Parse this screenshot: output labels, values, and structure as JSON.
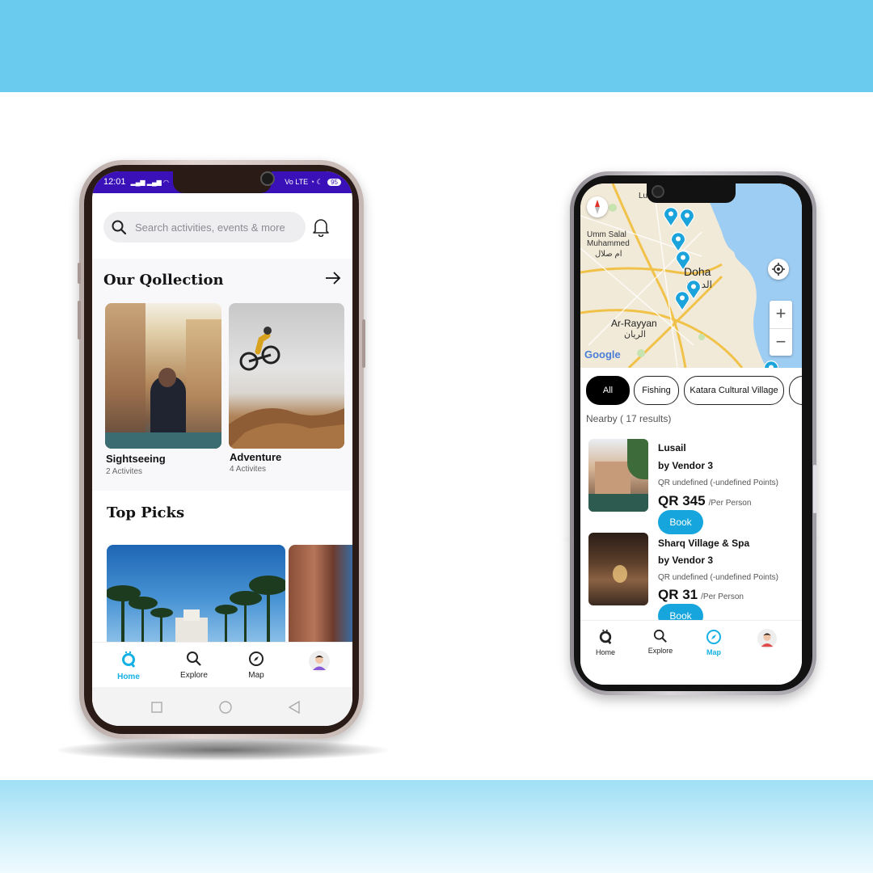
{
  "colors": {
    "brand_blue": "#16a6dd",
    "status_purple": "#3a10b8",
    "active_nav": "#16b1e4"
  },
  "phone1": {
    "status": {
      "time": "12:01",
      "battery": "95"
    },
    "search": {
      "placeholder": "Search activities, events & more",
      "search_icon": "search-icon",
      "bell_icon": "bell-icon"
    },
    "collection": {
      "title": "Our Qollection",
      "arrow_icon": "arrow-right-icon",
      "cards": [
        {
          "label": "Sightseeing",
          "sub": "2 Activites"
        },
        {
          "label": "Adventure",
          "sub": "4 Activites"
        }
      ]
    },
    "top_picks": {
      "title": "Top Picks"
    },
    "nav": [
      {
        "label": "Home",
        "icon": "home-icon",
        "active": true
      },
      {
        "label": "Explore",
        "icon": "search-icon"
      },
      {
        "label": "Map",
        "icon": "compass-icon"
      },
      {
        "label": "",
        "icon": "avatar"
      }
    ]
  },
  "phone2": {
    "map": {
      "labels": [
        "Lusail",
        "Umm Salal Muhammed",
        "ام صلال",
        "Doha",
        "الدوحة",
        "Ar-Rayyan",
        "الريان",
        "Google"
      ]
    },
    "chips": [
      "All",
      "Fishing",
      "Katara Cultural Village"
    ],
    "nearby": "Nearby ( 17 results)",
    "items": [
      {
        "title": "Lusail",
        "vendor": "by Vendor 3",
        "points": "QR undefined (-undefined Points)",
        "price": "QR 345",
        "per": "/Per Person",
        "book": "Book"
      },
      {
        "title": "Sharq Village & Spa",
        "vendor": "by Vendor 3",
        "points": "QR undefined (-undefined Points)",
        "price": "QR 31",
        "per": "/Per Person",
        "book": "Book"
      }
    ],
    "nav": [
      {
        "label": "Home",
        "icon": "home-icon"
      },
      {
        "label": "Explore",
        "icon": "search-icon"
      },
      {
        "label": "Map",
        "icon": "compass-icon",
        "active": true
      },
      {
        "label": "",
        "icon": "avatar"
      }
    ]
  }
}
